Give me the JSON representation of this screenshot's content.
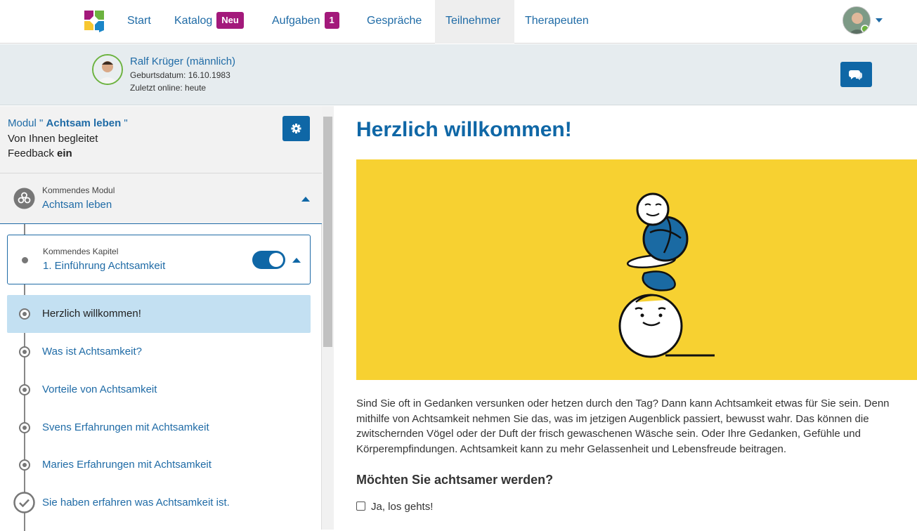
{
  "nav": {
    "items": [
      {
        "label": "Start"
      },
      {
        "label": "Katalog",
        "badge": "Neu"
      },
      {
        "label": "Aufgaben",
        "badge": "1"
      },
      {
        "label": "Gespräche"
      },
      {
        "label": "Teilnehmer",
        "active": true
      },
      {
        "label": "Therapeuten"
      }
    ],
    "user_avatar": "user-avatar",
    "menu_icon": "chevron-down-icon"
  },
  "patient": {
    "name": "Ralf Krüger (männlich)",
    "birthdate": "Geburtsdatum: 16.10.1983",
    "last_online": "Zuletzt online: heute",
    "chat_icon": "chat-icon"
  },
  "module": {
    "prefix": "Modul \"",
    "name": "Achtsam leben",
    "suffix": "\"",
    "accompanied": "Von Ihnen begleitet",
    "feedback_label": "Feedback",
    "feedback_value": "ein",
    "settings_icon": "gear-icon"
  },
  "upcoming_module": {
    "label": "Kommendes Modul",
    "name": "Achtsam leben"
  },
  "upcoming_chapter": {
    "label": "Kommendes Kapitel",
    "name": "1. Einführung Achtsamkeit",
    "toggle_on": true
  },
  "steps": [
    {
      "label": "Herzlich willkommen!",
      "active": true
    },
    {
      "label": "Was ist Achtsamkeit?"
    },
    {
      "label": "Vorteile von Achtsamkeit"
    },
    {
      "label": "Svens Erfahrungen mit Achtsamkeit"
    },
    {
      "label": "Maries Erfahrungen mit Achtsamkeit"
    },
    {
      "label": "Sie haben erfahren was Achtsamkeit ist.",
      "done": true
    }
  ],
  "content": {
    "title": "Herzlich willkommen!",
    "hero_color": "#f7d131",
    "intro": "Sind Sie oft in Gedanken versunken oder hetzen durch den Tag? Dann kann Achtsamkeit etwas für Sie sein. Denn mithilfe von Achtsamkeit nehmen Sie das, was im jetzigen Augenblick passiert, bewusst wahr. Das können die zwitschernden Vögel oder der Duft der frisch gewaschenen Wäsche sein. Oder Ihre Gedanken, Gefühle und Körperempfindungen. Achtsamkeit kann zu mehr Gelassenheit und Lebensfreude beitragen.",
    "question": "Möchten Sie achtsamer werden?",
    "checkbox_label": "Ja, los gehts!"
  },
  "colors": {
    "accent": "#0f67a6",
    "badge": "#a3197b",
    "active_step": "#c3e0f2"
  }
}
